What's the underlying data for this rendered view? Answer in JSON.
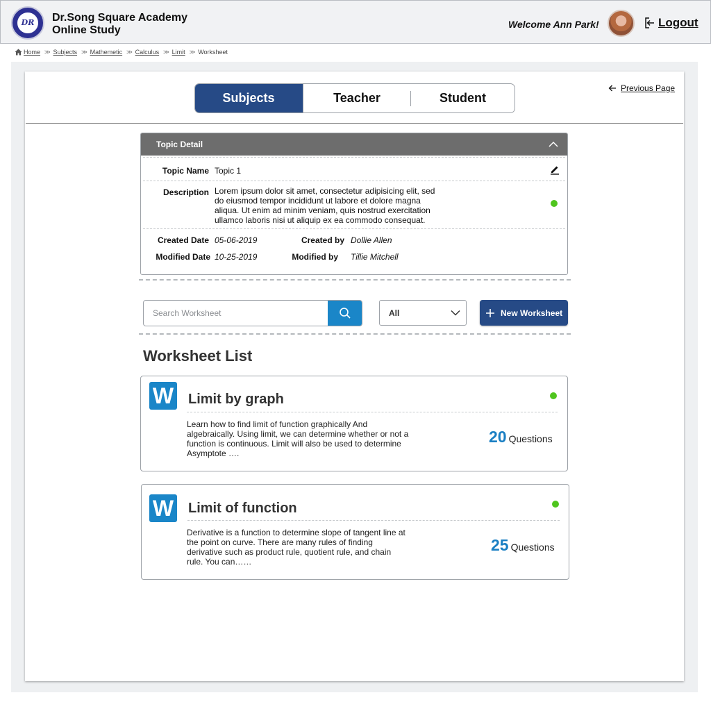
{
  "header": {
    "logo_text": "DR",
    "title_line1": "Dr.Song Square Academy",
    "title_line2": "Online Study",
    "welcome": "Welcome Ann Park!",
    "logout_label": "Logout"
  },
  "breadcrumb": {
    "items": [
      "Home",
      "Subjects",
      "Mathemetic",
      "Calculus",
      "Limit",
      "Worksheet"
    ]
  },
  "tabs": {
    "items": [
      "Subjects",
      "Teacher",
      "Student"
    ],
    "active": "Subjects"
  },
  "previous_page_label": "Previous Page",
  "topic_detail": {
    "header": "Topic Detail",
    "topic_name_label": "Topic Name",
    "topic_name": "Topic 1",
    "description_label": "Description",
    "description": "Lorem ipsum dolor sit amet, consectetur adipisicing elit, sed do eiusmod tempor incididunt ut labore et dolore magna aliqua. Ut enim ad minim veniam, quis nostrud exercitation ullamco laboris nisi ut aliquip ex ea commodo consequat.",
    "created_date_label": "Created Date",
    "created_date": "05-06-2019",
    "created_by_label": "Created by",
    "created_by": "Dollie Allen",
    "modified_date_label": "Modified Date",
    "modified_date": "10-25-2019",
    "modified_by_label": "Modified by",
    "modified_by": "Tillie Mitchell",
    "status_color": "#4fc51e"
  },
  "search": {
    "placeholder": "Search Worksheet"
  },
  "filter": {
    "selected": "All"
  },
  "new_worksheet_label": "New Worksheet",
  "worksheet_list": {
    "title": "Worksheet List",
    "items": [
      {
        "icon_letter": "W",
        "title": "Limit by graph",
        "description": "Learn how to find limit of function graphically And algebraically. Using limit, we can determine whether or not a function is continuous. Limit will also be used to determine Asymptote ….",
        "question_count": "20",
        "question_label": "Questions"
      },
      {
        "icon_letter": "W",
        "title": "Limit of function",
        "description": "Derivative is a function to determine slope of tangent line at the point on curve. There are many rules of finding derivative such as product rule, quotient rule, and chain rule. You can……",
        "question_count": "25",
        "question_label": "Questions"
      }
    ]
  },
  "colors": {
    "primary": "#264a86",
    "accent": "#1a86c8",
    "status_green": "#4fc51e",
    "header_bg": "#f1f2f4",
    "topic_header_bg": "#6d6d6d"
  }
}
